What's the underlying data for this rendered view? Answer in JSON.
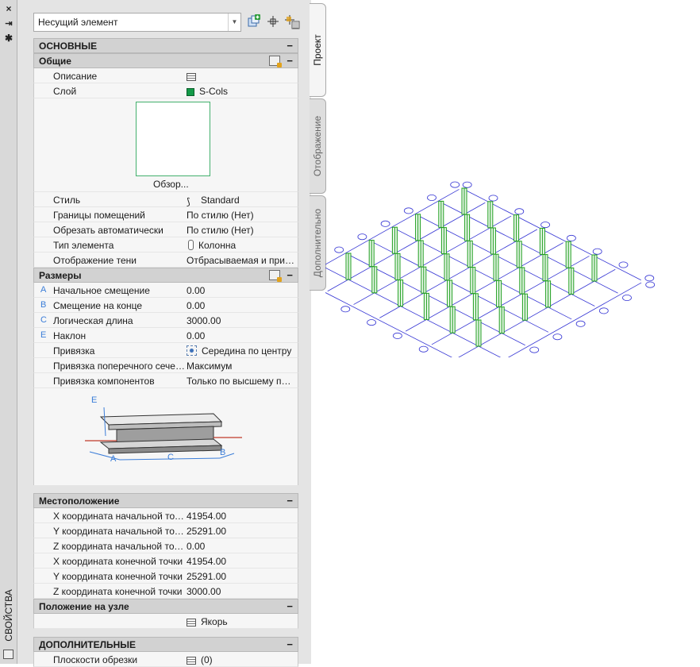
{
  "window": {
    "title": "СВОЙСТВА",
    "close_icon": "×",
    "pin_icon": "⇥",
    "settings_icon": "✱"
  },
  "selector": {
    "value": "Несущий элемент",
    "tools": [
      "add-selection-icon",
      "quick-select-icon",
      "select-objects-icon"
    ]
  },
  "sections": {
    "basic": "ОСНОВНЫЕ",
    "general": "Общие",
    "dimensions": "Размеры",
    "location": "Местоположение",
    "node_position": "Положение на узле",
    "additional": "ДОПОЛНИТЕЛЬНЫЕ"
  },
  "general_rows": {
    "description": {
      "name": "Описание",
      "value": ""
    },
    "layer": {
      "name": "Слой",
      "value": "S-Cols"
    },
    "preview_caption": "Обзор...",
    "style": {
      "name": "Стиль",
      "value": "Standard"
    },
    "room_bounding": {
      "name": "Границы помещений",
      "value": "По стилю (Нет)"
    },
    "auto_trim": {
      "name": "Обрезать автоматически",
      "value": "По стилю (Нет)"
    },
    "member_type": {
      "name": "Тип элемента",
      "value": "Колонна"
    },
    "shadow_display": {
      "name": "Отображение тени",
      "value": "Отбрасываемая и принимаемая"
    }
  },
  "dimension_rows": [
    {
      "letter": "A",
      "name": "Начальное смещение",
      "value": "0.00"
    },
    {
      "letter": "B",
      "name": "Смещение на конце",
      "value": "0.00"
    },
    {
      "letter": "C",
      "name": "Логическая длина",
      "value": "3000.00"
    },
    {
      "letter": "E",
      "name": "Наклон",
      "value": "0.00"
    },
    {
      "letter": "",
      "name": "Привязка",
      "value": "Середина по центру"
    },
    {
      "letter": "",
      "name": "Привязка поперечного сечения",
      "value": "Максимум"
    },
    {
      "letter": "",
      "name": "Привязка компонентов",
      "value": "Только по высшему приоритету"
    }
  ],
  "diagram_labels": {
    "e": "E",
    "a": "A",
    "c": "C",
    "b": "B"
  },
  "location_rows": [
    {
      "name": "X координата начальной точки",
      "value": "41954.00"
    },
    {
      "name": "Y координата начальной точки",
      "value": "25291.00"
    },
    {
      "name": "Z координата начальной точки",
      "value": "0.00"
    },
    {
      "name": "X координата конечной точки",
      "value": "41954.00"
    },
    {
      "name": "Y координата конечной точки",
      "value": "25291.00"
    },
    {
      "name": "Z координата конечной точки",
      "value": "3000.00"
    }
  ],
  "node_row": {
    "value": "Якорь"
  },
  "additional_rows": [
    {
      "name": "Плоскости обрезки",
      "value": "(0)"
    }
  ],
  "tabs": [
    "Проект",
    "Отображение",
    "Дополнительно"
  ],
  "colors": {
    "grid_line": "#3535d4",
    "column": "#1f9e1f",
    "layer": "#139a48",
    "dimension_letter": "#3b7dd8"
  },
  "grid": {
    "rows": 6,
    "cols": 6
  }
}
